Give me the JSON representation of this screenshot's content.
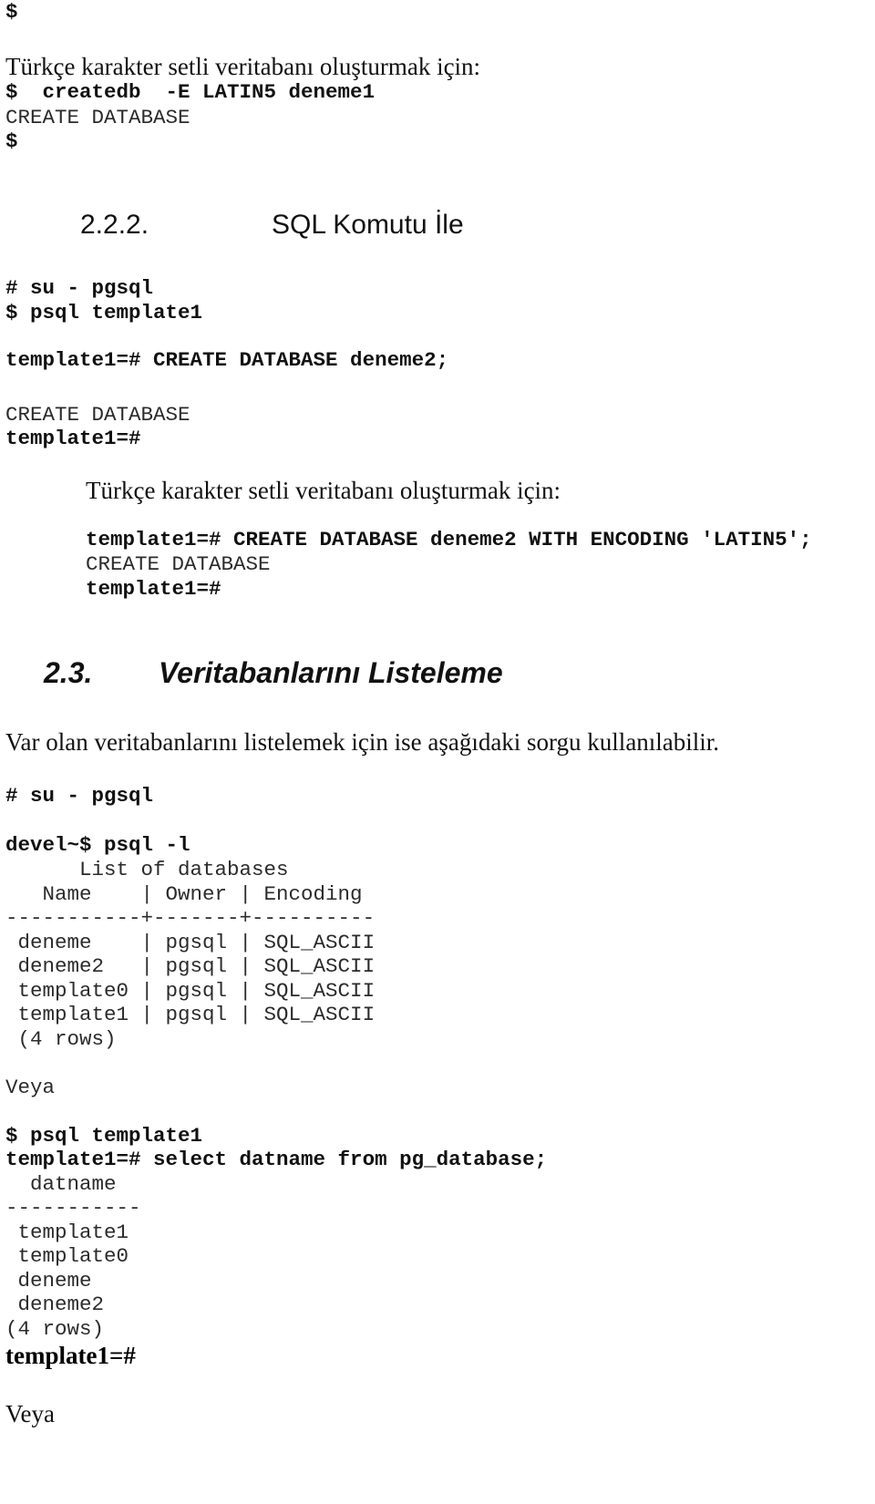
{
  "section_a": {
    "prompt_top": "$",
    "turkish_intro": "Türkçe karakter setli veritabanı oluşturmak için:",
    "cmd_createdb": "$  createdb  -E LATIN5 deneme1",
    "result_create": "CREATE DATABASE",
    "prompt_after": "$"
  },
  "heading_222": {
    "number": "2.2.2.",
    "title": "SQL Komutu İle"
  },
  "section_b": {
    "cmd_su": "# su - pgsql",
    "cmd_psql": "$ psql template1",
    "cmd_create": "template1=# CREATE DATABASE deneme2;",
    "result_create": "CREATE DATABASE",
    "prompt": "template1=#",
    "turkish_intro": "Türkçe karakter setli veritabanı oluşturmak için:",
    "cmd_create_enc": "template1=# CREATE DATABASE deneme2 WITH ENCODING 'LATIN5';",
    "result_create_enc": "CREATE DATABASE",
    "prompt_enc": "template1=#"
  },
  "heading_23": {
    "number": "2.3.",
    "title": "Veritabanlarını Listeleme"
  },
  "section_c": {
    "intro": "Var olan veritabanlarını listelemek için ise aşağıdaki sorgu kullanılabilir.",
    "cmd_su": "# su - pgsql",
    "cmd_list": "devel~$ psql -l",
    "table_title": "      List of databases",
    "table_header": "   Name    | Owner | Encoding",
    "table_sep": "-----------+-------+----------",
    "table_rows": [
      " deneme    | pgsql | SQL_ASCII",
      " deneme2   | pgsql | SQL_ASCII",
      " template0 | pgsql | SQL_ASCII",
      " template1 | pgsql | SQL_ASCII"
    ],
    "table_count": " (4 rows)",
    "or_1": "Veya",
    "cmd_psql": "$ psql template1",
    "cmd_select": "template1=# select datname from pg_database;",
    "q_header": "  datname",
    "q_sep": "-----------",
    "q_rows": [
      " template1",
      " template0",
      " deneme",
      " deneme2"
    ],
    "q_count": "(4 rows)",
    "prompt_end": "template1=#",
    "or_2": "Veya"
  }
}
